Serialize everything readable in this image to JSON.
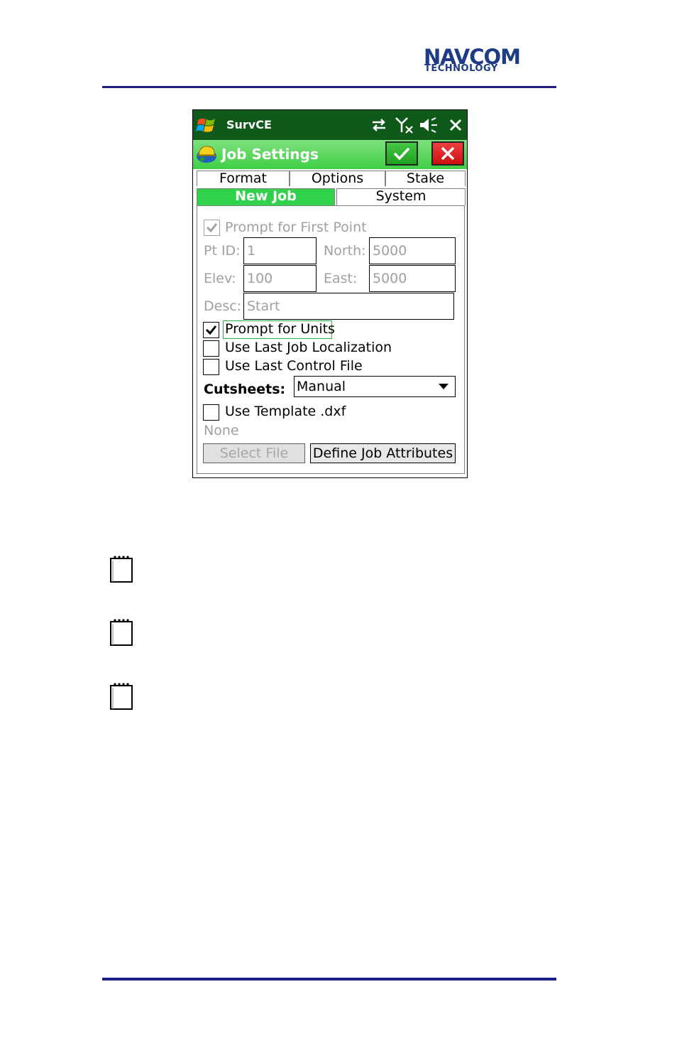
{
  "header": {
    "logo_line1": "NAVCOM",
    "logo_line2": "TECHNOLOGY"
  },
  "colors": {
    "brand": "#1e3b86",
    "status_bar": "#0f5a1a",
    "title_bar": "#3fcf45",
    "active_tab": "#2fd24a"
  },
  "device": {
    "status_bar": {
      "app_name": "SurvCE",
      "icons": [
        "windows-start-icon",
        "sync-arrows-icon",
        "no-signal-icon",
        "speaker-muted-icon",
        "close-icon"
      ]
    },
    "title_bar": {
      "title": "Job Settings",
      "icons": [
        "hard-hat-icon",
        "ok-check-icon",
        "cancel-x-icon"
      ]
    },
    "tabs_row1": [
      "Format",
      "Options",
      "Stake"
    ],
    "tabs_row2": [
      "New Job",
      "System"
    ],
    "active_tab": "New Job",
    "form": {
      "prompt_first_point": {
        "label": "Prompt for First Point",
        "checked": true,
        "enabled": false
      },
      "pt_id": {
        "label": "Pt ID:",
        "value": "1"
      },
      "north": {
        "label": "North:",
        "value": "5000"
      },
      "elev": {
        "label": "Elev:",
        "value": "100"
      },
      "east": {
        "label": "East:",
        "value": "5000"
      },
      "desc": {
        "label": "Desc:",
        "value": "Start"
      },
      "prompt_units": {
        "label": "Prompt for Units",
        "checked": true
      },
      "use_last_localization": {
        "label": "Use Last Job Localization",
        "checked": false
      },
      "use_last_control": {
        "label": "Use Last Control File",
        "checked": false
      },
      "cutsheets": {
        "label": "Cutsheets:",
        "value": "Manual"
      },
      "use_template": {
        "label": "Use Template .dxf",
        "checked": false
      },
      "template_file": "None",
      "select_file_button": "Select File",
      "define_attributes_button": "Define Job Attributes"
    }
  },
  "notes": {
    "count": 3,
    "icon": "notepad-icon"
  }
}
